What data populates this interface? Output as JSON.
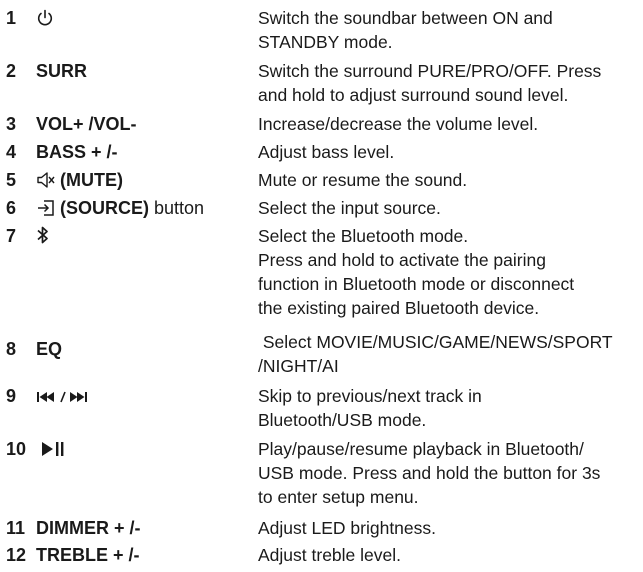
{
  "items": [
    {
      "num": "1",
      "label": "",
      "suffix": "",
      "icon": "power-icon",
      "desc": [
        "Switch the soundbar between ON and",
        "STANDBY mode."
      ]
    },
    {
      "num": "2",
      "label": "SURR",
      "suffix": "",
      "icon": "",
      "desc": [
        "Switch the surround PURE/PRO/OFF. Press",
        "and hold to adjust surround sound level."
      ]
    },
    {
      "num": "3",
      "label": "VOL+ /VOL-",
      "suffix": "",
      "icon": "",
      "desc": [
        "Increase/decrease the volume level."
      ]
    },
    {
      "num": "4",
      "label": "BASS + /-",
      "suffix": "",
      "icon": "",
      "desc": [
        "Adjust bass level."
      ]
    },
    {
      "num": "5",
      "label": "(MUTE)",
      "suffix": "",
      "icon": "mute-icon",
      "desc": [
        "Mute or resume the sound."
      ]
    },
    {
      "num": "6",
      "label": "(SOURCE)",
      "suffix": "button",
      "icon": "source-icon",
      "desc": [
        "Select the input source."
      ]
    },
    {
      "num": "7",
      "label": "",
      "suffix": "",
      "icon": "bluetooth-icon",
      "desc": [
        "Select the Bluetooth mode.",
        "Press and hold to activate the pairing",
        "function in Bluetooth mode or disconnect",
        "the existing paired Bluetooth device."
      ]
    },
    {
      "num": "8",
      "label": "EQ",
      "suffix": "",
      "icon": "",
      "desc": [
        " Select MOVIE/MUSIC/GAME/NEWS/SPORT",
        "/NIGHT/AI"
      ]
    },
    {
      "num": "9",
      "label": "",
      "suffix": "",
      "icon": "prev-next-icon",
      "desc": [
        "Skip to previous/next track in",
        "Bluetooth/USB mode."
      ]
    },
    {
      "num": "10",
      "label": "",
      "suffix": "",
      "icon": "play-pause-icon",
      "desc": [
        "Play/pause/resume playback in Bluetooth/",
        "USB mode. Press and hold the button for 3s",
        "to enter setup menu."
      ]
    },
    {
      "num": "11",
      "label": "DIMMER + /-",
      "suffix": "",
      "icon": "",
      "desc": [
        "Adjust LED brightness."
      ]
    },
    {
      "num": "12",
      "label": "TREBLE + /-",
      "suffix": "",
      "icon": "",
      "desc": [
        "Adjust treble level."
      ]
    }
  ]
}
